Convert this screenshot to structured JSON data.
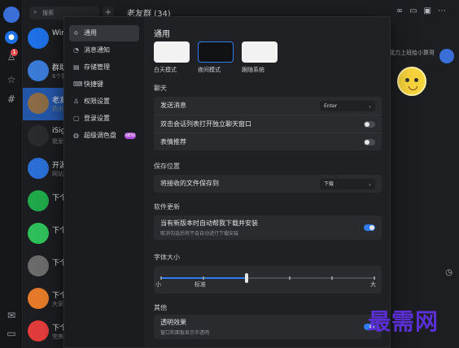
{
  "chatlist": {
    "search_placeholder": "搜索",
    "add_label": "+",
    "items": [
      {
        "name": "Win",
        "sub": "",
        "color": "#1f6fe5"
      },
      {
        "name": "群助",
        "sub": "6个群",
        "color": "#3b7bd8"
      },
      {
        "name": "老友",
        "sub": "药水",
        "color": "#8a6b45"
      },
      {
        "name": "iSig",
        "sub": "我爱",
        "color": "#2a2b2f"
      },
      {
        "name": "开源",
        "sub": "网站",
        "color": "#2b6fd6"
      },
      {
        "name": "下个",
        "sub": "",
        "color": "#1fa84a"
      },
      {
        "name": "下个",
        "sub": "",
        "color": "#2fbf5a"
      },
      {
        "name": "下个",
        "sub": "",
        "color": "#6b6b6b"
      },
      {
        "name": "下个",
        "sub": "大家",
        "color": "#e47a2a"
      },
      {
        "name": "下个",
        "sub": "完美",
        "color": "#e23b3b"
      }
    ]
  },
  "chatwin": {
    "title": "老友群 (34)",
    "right_msg": "我力上班给小算哥"
  },
  "settings": {
    "nav": [
      {
        "label": "通用",
        "icon": "≑"
      },
      {
        "label": "消息通知",
        "icon": "◔"
      },
      {
        "label": "存储管理",
        "icon": "▤"
      },
      {
        "label": "快捷键",
        "icon": "⌨"
      },
      {
        "label": "权限设置",
        "icon": "♙"
      },
      {
        "label": "登录设置",
        "icon": "▢"
      },
      {
        "label": "超级调色盘",
        "icon": "◍",
        "tag": "NEW"
      }
    ],
    "title": "通用",
    "themes": [
      {
        "label": "白天模式",
        "color": "#f2f2f2"
      },
      {
        "label": "夜间模式",
        "color": "#111214"
      },
      {
        "label": "跟随系统",
        "color": "#f2f2f2"
      }
    ],
    "chat_section": {
      "heading": "聊天",
      "send_label": "发送消息",
      "send_value": "Enter",
      "dblclick_label": "双击会话列表打开独立聊天窗口",
      "dblclick_on": false,
      "emoji_label": "表情推荐",
      "emoji_on": false
    },
    "save_section": {
      "heading": "保存位置",
      "save_label": "将接收的文件保存到",
      "save_value": "下载"
    },
    "update_section": {
      "heading": "软件更新",
      "auto_label": "当有新版本时自动帮我下载并安装",
      "auto_sub": "取消勾选后将不会自动进行下载安装",
      "auto_on": true
    },
    "font_section": {
      "heading": "字体大小",
      "level": 0.4,
      "min_label": "小",
      "mid_label": "标准",
      "max_label": "大"
    },
    "other_section": {
      "heading": "其他",
      "transp_label": "透明效果",
      "transp_sub": "窗口和面板显示半透明",
      "transp_on": true
    }
  },
  "watermark": "最需网",
  "colors": {
    "accent": "#2f7bf0",
    "badge": "#e34d4d",
    "watermark": "#5b2fd6"
  }
}
